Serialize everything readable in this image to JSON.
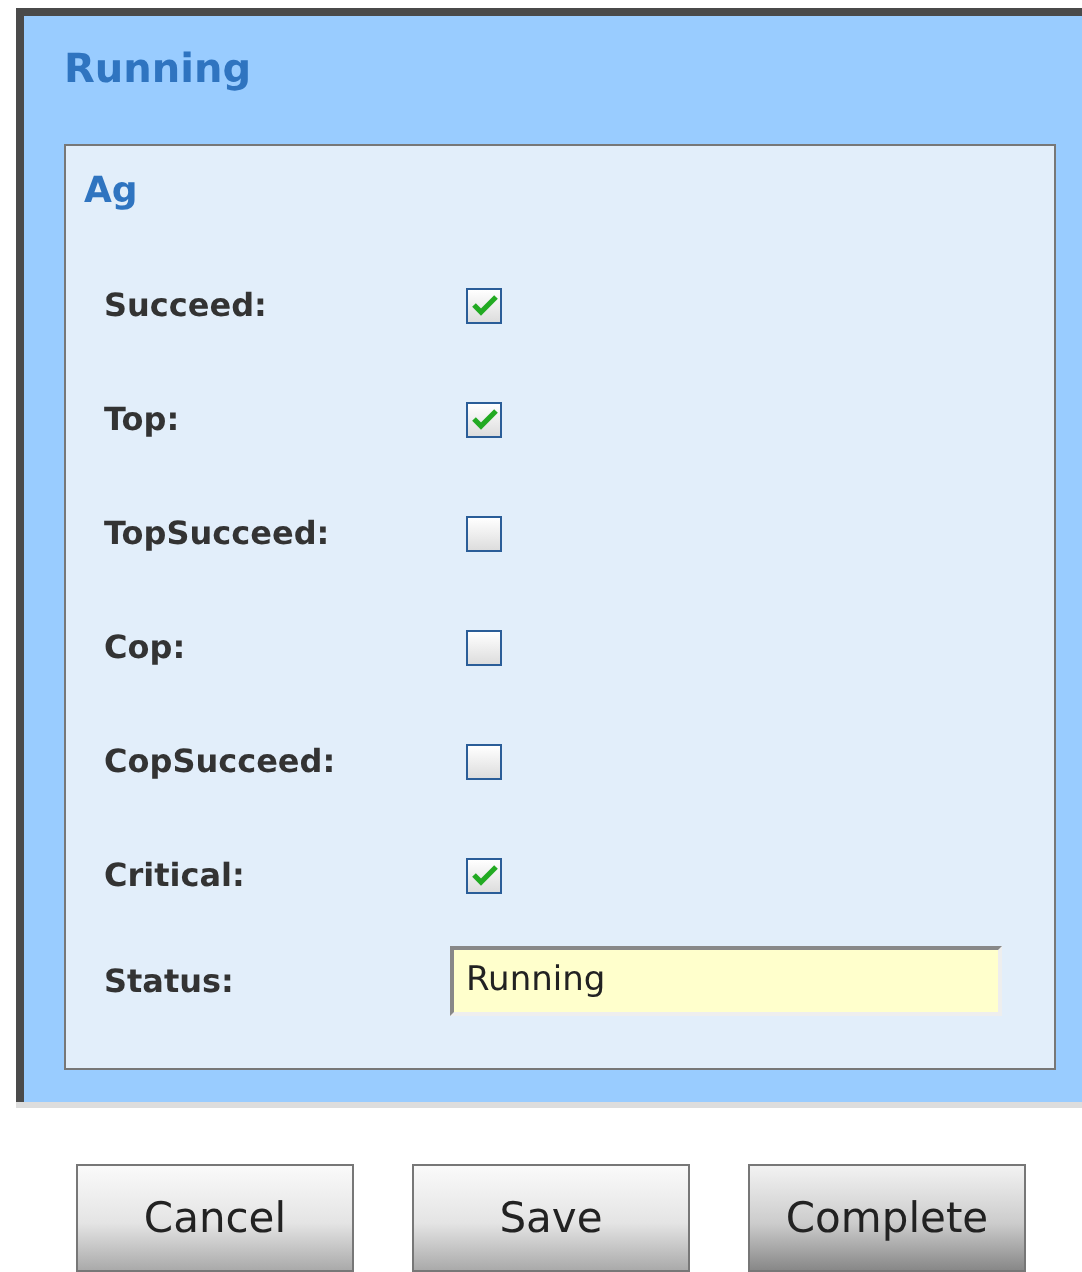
{
  "panel": {
    "title": "Running"
  },
  "group": {
    "title": "Ag",
    "fields": [
      {
        "kind": "checkbox",
        "label": "Succeed:",
        "checked": true
      },
      {
        "kind": "checkbox",
        "label": "Top:",
        "checked": true
      },
      {
        "kind": "checkbox",
        "label": "TopSucceed:",
        "checked": false
      },
      {
        "kind": "checkbox",
        "label": "Cop:",
        "checked": false
      },
      {
        "kind": "checkbox",
        "label": "CopSucceed:",
        "checked": false
      },
      {
        "kind": "checkbox",
        "label": "Critical:",
        "checked": true
      },
      {
        "kind": "text",
        "label": "Status:",
        "value": "Running"
      }
    ]
  },
  "buttons": [
    "Cancel",
    "Save",
    "Complete"
  ]
}
